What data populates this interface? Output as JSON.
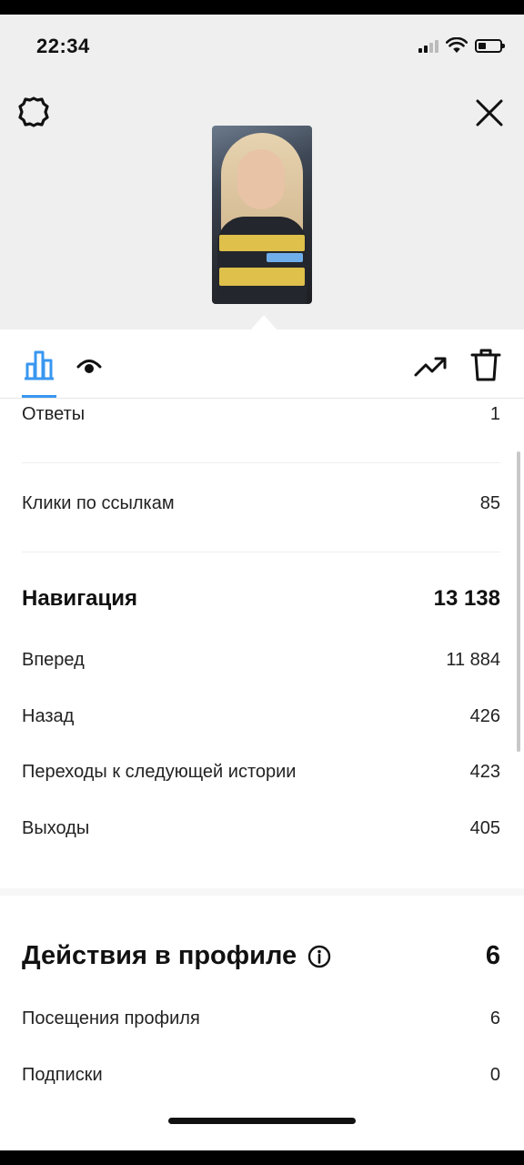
{
  "status_bar": {
    "time": "22:34"
  },
  "header": {
    "settings_icon": "gear-icon",
    "close_icon": "close-icon",
    "story_thumbnail": "story-preview"
  },
  "tabs": {
    "insights_icon": "bar-chart-icon",
    "viewers_icon": "eye-icon",
    "promote_icon": "trending-up-icon",
    "delete_icon": "trash-icon",
    "accent": "#3897f0"
  },
  "stats": {
    "replies": {
      "label": "Ответы",
      "value": "1"
    },
    "link_clicks": {
      "label": "Клики по ссылкам",
      "value": "85"
    },
    "navigation": {
      "title": "Навигация",
      "total": "13 138",
      "items": [
        {
          "label": "Вперед",
          "value": "11 884"
        },
        {
          "label": "Назад",
          "value": "426"
        },
        {
          "label": "Переходы к следующей истории",
          "value": "423"
        },
        {
          "label": "Выходы",
          "value": "405"
        }
      ]
    },
    "profile_actions": {
      "title": "Действия в профиле",
      "total": "6",
      "items": [
        {
          "label": "Посещения профиля",
          "value": "6"
        },
        {
          "label": "Подписки",
          "value": "0"
        }
      ]
    }
  }
}
